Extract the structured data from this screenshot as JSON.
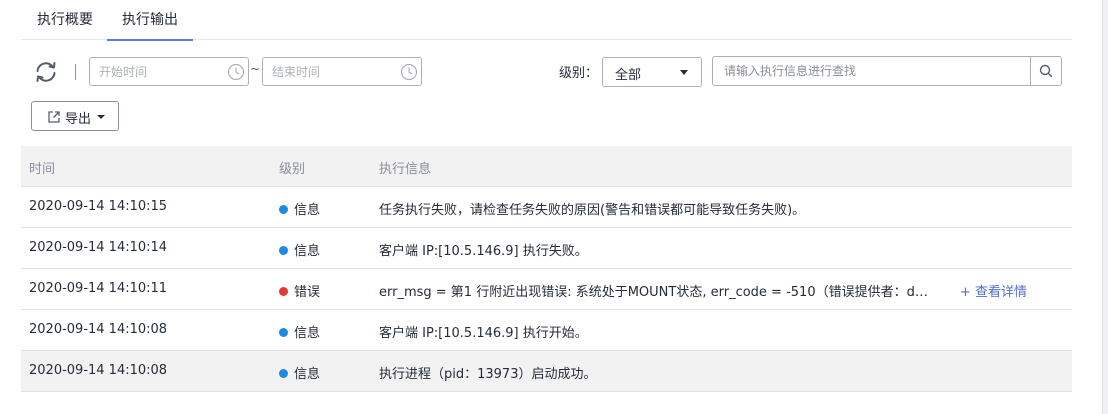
{
  "tabs": [
    {
      "label": "执行概要",
      "active": false
    },
    {
      "label": "执行输出",
      "active": true
    }
  ],
  "toolbar": {
    "refresh_icon": "refresh-icon",
    "start_placeholder": "开始时间",
    "end_placeholder": "结束时间",
    "range_separator": "~",
    "clock_icon": "clock-icon",
    "level_label": "级别：",
    "level_value": "全部",
    "search_placeholder": "请输入执行信息进行查找",
    "search_icon": "search-icon",
    "export_label": "导出",
    "export_icon": "external-link-icon"
  },
  "table": {
    "columns": [
      "时间",
      "级别",
      "执行信息"
    ],
    "rows": [
      {
        "time": "2020-09-14 14:10:15",
        "level": "信息",
        "level_color": "#1e88e5",
        "message": "任务执行失败，请检查任务失败的原因(警告和错误都可能导致任务失败)。",
        "link": ""
      },
      {
        "time": "2020-09-14 14:10:14",
        "level": "信息",
        "level_color": "#1e88e5",
        "message": "客户端 IP:[10.5.146.9] 执行失败。",
        "link": ""
      },
      {
        "time": "2020-09-14 14:10:11",
        "level": "错误",
        "level_color": "#e53935",
        "message": "err_msg = 第1 行附近出现错误: 系统处于MOUNT状态, err_code = -510（错误提供者：d…",
        "link": "+ 查看详情"
      },
      {
        "time": "2020-09-14 14:10:08",
        "level": "信息",
        "level_color": "#1e88e5",
        "message": "客户端 IP:[10.5.146.9] 执行开始。",
        "link": ""
      },
      {
        "time": "2020-09-14 14:10:08",
        "level": "信息",
        "level_color": "#1e88e5",
        "message": "执行进程（pid：13973）启动成功。",
        "link": ""
      }
    ]
  },
  "colors": {
    "accent": "#5e7ce0",
    "link": "#526ecc",
    "info": "#1e88e5",
    "error": "#e53935"
  }
}
